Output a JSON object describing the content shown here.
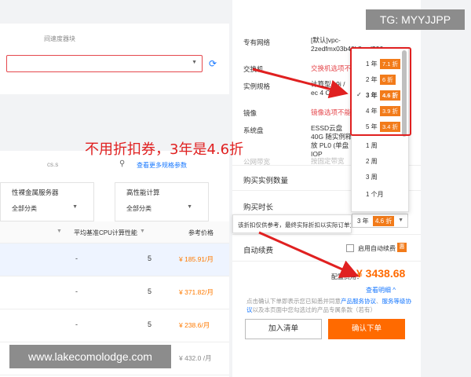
{
  "left": {
    "zone_label": "间速度器块",
    "search_text": "cs.s",
    "more_link": "查看更多规格参数",
    "filters": [
      {
        "title": "性裸金属服务器",
        "value": "全部分类"
      },
      {
        "title": "高性能计算",
        "value": "全部分类"
      }
    ],
    "table": {
      "headers": [
        "平均基准CPU计算性能",
        "参考价格"
      ],
      "rows": [
        {
          "cpu": "-",
          "sep": "5",
          "price": "¥ 185.91/月"
        },
        {
          "cpu": "-",
          "sep": "5",
          "price": "¥ 371.82/月"
        },
        {
          "cpu": "-",
          "sep": "5",
          "price": "¥ 238.6/月"
        },
        {
          "cpu": "-",
          "sep": "5",
          "price": "¥ 432.0 /月"
        }
      ]
    }
  },
  "right": {
    "specs": [
      {
        "label": "专有网络",
        "value": "[默认]vpc-2zedfmx03b40k8vml506n"
      },
      {
        "label": "交换机",
        "value": "交换机选项不能"
      },
      {
        "label": "实例规格",
        "value": "计算型 c9i / ec 4 C"
      },
      {
        "label": "镜像",
        "value": "镜像选项不能"
      },
      {
        "label": "系统盘",
        "value": "ESSD云盘 40G 随实例释放 PL0 (单盘IOP"
      },
      {
        "label": "公网带宽",
        "value": "按固定带宽"
      }
    ],
    "purchase_qty_label": "购买实例数量",
    "purchase_dur_label": "购买时长",
    "selected_duration": {
      "year": "3 年",
      "discount": "4.6 折"
    },
    "tooltip": "该折扣仅供参考，最终实际折扣以实际订单为准",
    "auto_renew_label": "自动续费",
    "auto_renew_option": "启用自动续费",
    "auto_badge": "惠",
    "fee_label": "配置费用：",
    "fee_value": "¥ 3438.68",
    "detail_link": "查看明细 ^",
    "terms": {
      "prefix": "点击确认下单即表示您已知悉并同意",
      "link1": "产品服务协议",
      "mid": "、",
      "link2": "服务等级协议",
      "suffix": "以及本页面中您勾选过的产品专属条款（若有）"
    },
    "add_cart": "加入清单",
    "confirm_order": "确认下单"
  },
  "dropdown": {
    "items": [
      {
        "year": "1 年",
        "discount": "7.1 折"
      },
      {
        "year": "2 年",
        "discount": "6 折"
      },
      {
        "year": "3 年",
        "discount": "4.6 折",
        "check": "✓"
      },
      {
        "year": "4 年",
        "discount": "3.9 折"
      },
      {
        "year": "5 年",
        "discount": "3.4 折"
      },
      {
        "year": "1 周",
        "discount": ""
      },
      {
        "year": "2 周",
        "discount": ""
      },
      {
        "year": "3 周",
        "discount": ""
      },
      {
        "year": "1 个月",
        "discount": ""
      }
    ]
  },
  "annotation": "不用折扣券，3年是4.6折",
  "tg_badge": "TG: MYYJJPP",
  "watermark": "www.lakecomolodge.com",
  "colors": {
    "accent": "#ff6a00",
    "discount": "#f27b1a",
    "annotation": "#e02020",
    "link": "#1677ff"
  }
}
